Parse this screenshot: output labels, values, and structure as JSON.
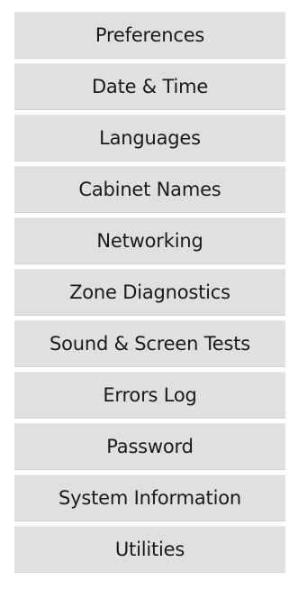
{
  "menu": {
    "items": [
      {
        "label": "Preferences"
      },
      {
        "label": "Date & Time"
      },
      {
        "label": "Languages"
      },
      {
        "label": "Cabinet Names"
      },
      {
        "label": "Networking"
      },
      {
        "label": "Zone Diagnostics"
      },
      {
        "label": "Sound & Screen Tests"
      },
      {
        "label": "Errors Log"
      },
      {
        "label": "Password"
      },
      {
        "label": "System Information"
      },
      {
        "label": "Utilities"
      }
    ]
  }
}
